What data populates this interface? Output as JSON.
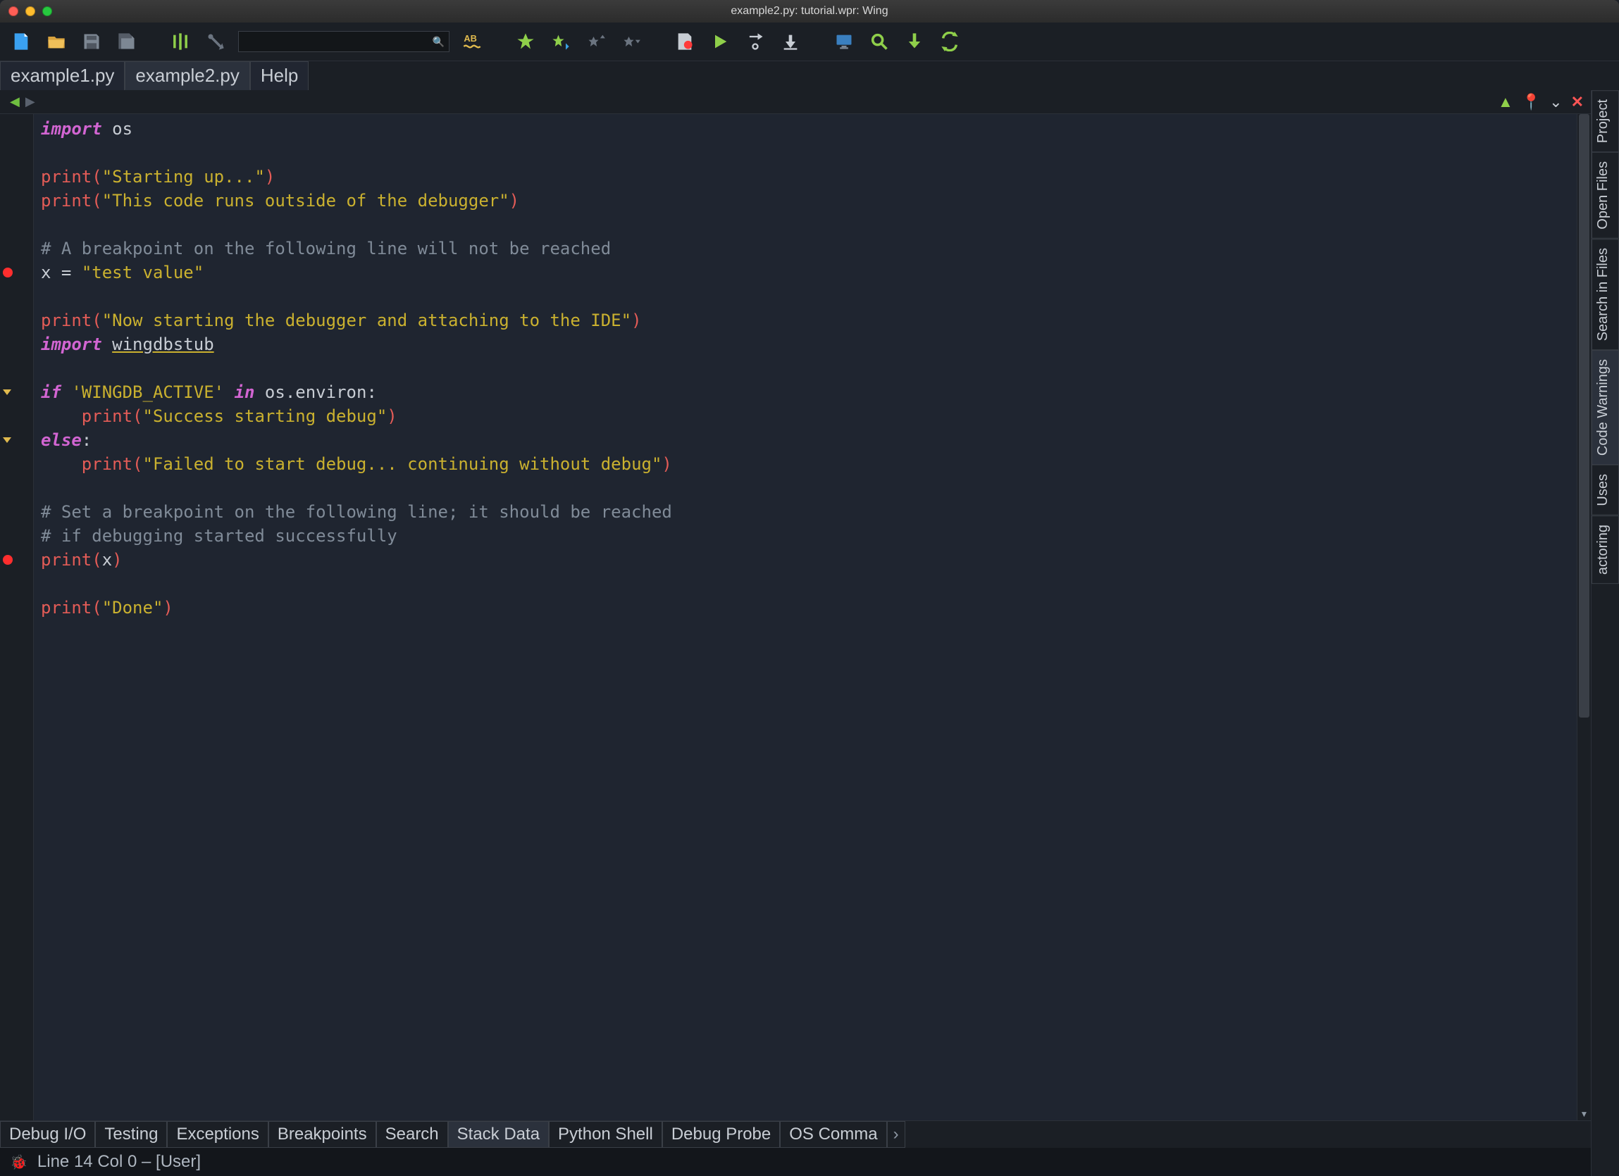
{
  "window": {
    "title": "example2.py: tutorial.wpr: Wing"
  },
  "file_tabs": {
    "items": [
      {
        "label": "example1.py",
        "active": false
      },
      {
        "label": "example2.py",
        "active": true
      },
      {
        "label": "Help",
        "active": false
      }
    ]
  },
  "right_tabs": {
    "items": [
      {
        "label": "Project",
        "active": false
      },
      {
        "label": "Open Files",
        "active": false
      },
      {
        "label": "Search in Files",
        "active": false
      },
      {
        "label": "Code Warnings",
        "active": true
      },
      {
        "label": "Uses",
        "active": false
      },
      {
        "label": "actoring",
        "active": false,
        "cut": true
      }
    ]
  },
  "bottom_tabs": {
    "items": [
      {
        "label": "Debug I/O",
        "active": false
      },
      {
        "label": "Testing",
        "active": false
      },
      {
        "label": "Exceptions",
        "active": false
      },
      {
        "label": "Breakpoints",
        "active": false
      },
      {
        "label": "Search",
        "active": false
      },
      {
        "label": "Stack Data",
        "active": true
      },
      {
        "label": "Python Shell",
        "active": false
      },
      {
        "label": "Debug Probe",
        "active": false
      },
      {
        "label": "OS Comma",
        "active": false
      }
    ]
  },
  "status": {
    "text": "Line 14 Col 0 – [User]"
  },
  "colors": {
    "green": "#8fcf4a",
    "red": "#ff5555",
    "yellow": "#e0ba4e",
    "blue": "#5aa0ff"
  },
  "code": {
    "lines": [
      {
        "gutter": "",
        "tokens": [
          [
            "kw",
            "import"
          ],
          [
            "sp",
            " "
          ],
          [
            "id",
            "os"
          ]
        ]
      },
      {
        "gutter": "",
        "tokens": []
      },
      {
        "gutter": "",
        "tokens": [
          [
            "fn",
            "print"
          ],
          [
            "paren",
            "("
          ],
          [
            "str",
            "\"Starting up...\""
          ],
          [
            "paren",
            ")"
          ]
        ]
      },
      {
        "gutter": "",
        "tokens": [
          [
            "fn",
            "print"
          ],
          [
            "paren",
            "("
          ],
          [
            "str",
            "\"This code runs outside of the debugger\""
          ],
          [
            "paren",
            ")"
          ]
        ]
      },
      {
        "gutter": "",
        "tokens": []
      },
      {
        "gutter": "",
        "tokens": [
          [
            "cmt",
            "# A breakpoint on the following line will not be reached"
          ]
        ]
      },
      {
        "gutter": "bp",
        "tokens": [
          [
            "id",
            "x "
          ],
          [
            "op",
            "="
          ],
          [
            "id",
            " "
          ],
          [
            "str",
            "\"test value\""
          ]
        ]
      },
      {
        "gutter": "",
        "tokens": []
      },
      {
        "gutter": "",
        "tokens": [
          [
            "fn",
            "print"
          ],
          [
            "paren",
            "("
          ],
          [
            "str",
            "\"Now starting the debugger and attaching to the IDE\""
          ],
          [
            "paren",
            ")"
          ]
        ]
      },
      {
        "gutter": "",
        "tokens": [
          [
            "kw",
            "import"
          ],
          [
            "sp",
            " "
          ],
          [
            "und",
            "wingdbstub"
          ]
        ]
      },
      {
        "gutter": "",
        "tokens": []
      },
      {
        "gutter": "fold",
        "tokens": [
          [
            "kw",
            "if"
          ],
          [
            "sp",
            " "
          ],
          [
            "str",
            "'WINGDB_ACTIVE'"
          ],
          [
            "sp",
            " "
          ],
          [
            "kw",
            "in"
          ],
          [
            "sp",
            " "
          ],
          [
            "id",
            "os"
          ],
          [
            "dot",
            "."
          ],
          [
            "id",
            "environ"
          ],
          [
            "op",
            ":"
          ]
        ]
      },
      {
        "gutter": "",
        "tokens": [
          [
            "sp",
            "    "
          ],
          [
            "fn",
            "print"
          ],
          [
            "paren",
            "("
          ],
          [
            "str",
            "\"Success starting debug\""
          ],
          [
            "paren",
            ")"
          ]
        ]
      },
      {
        "gutter": "fold",
        "tokens": [
          [
            "kw",
            "else"
          ],
          [
            "op",
            ":"
          ]
        ]
      },
      {
        "gutter": "",
        "tokens": [
          [
            "sp",
            "    "
          ],
          [
            "fn",
            "print"
          ],
          [
            "paren",
            "("
          ],
          [
            "str",
            "\"Failed to start debug... continuing without debug\""
          ],
          [
            "paren",
            ")"
          ]
        ]
      },
      {
        "gutter": "",
        "tokens": []
      },
      {
        "gutter": "",
        "tokens": [
          [
            "cmt",
            "# Set a breakpoint on the following line; it should be reached"
          ]
        ]
      },
      {
        "gutter": "",
        "tokens": [
          [
            "cmt",
            "# if debugging started successfully"
          ]
        ]
      },
      {
        "gutter": "bp",
        "tokens": [
          [
            "fn",
            "print"
          ],
          [
            "paren",
            "("
          ],
          [
            "id",
            "x"
          ],
          [
            "paren",
            ")"
          ]
        ]
      },
      {
        "gutter": "",
        "tokens": []
      },
      {
        "gutter": "",
        "tokens": [
          [
            "fn",
            "print"
          ],
          [
            "paren",
            "("
          ],
          [
            "str",
            "\"Done\""
          ],
          [
            "paren",
            ")"
          ]
        ]
      },
      {
        "gutter": "",
        "tokens": []
      },
      {
        "gutter": "",
        "tokens": []
      }
    ]
  }
}
